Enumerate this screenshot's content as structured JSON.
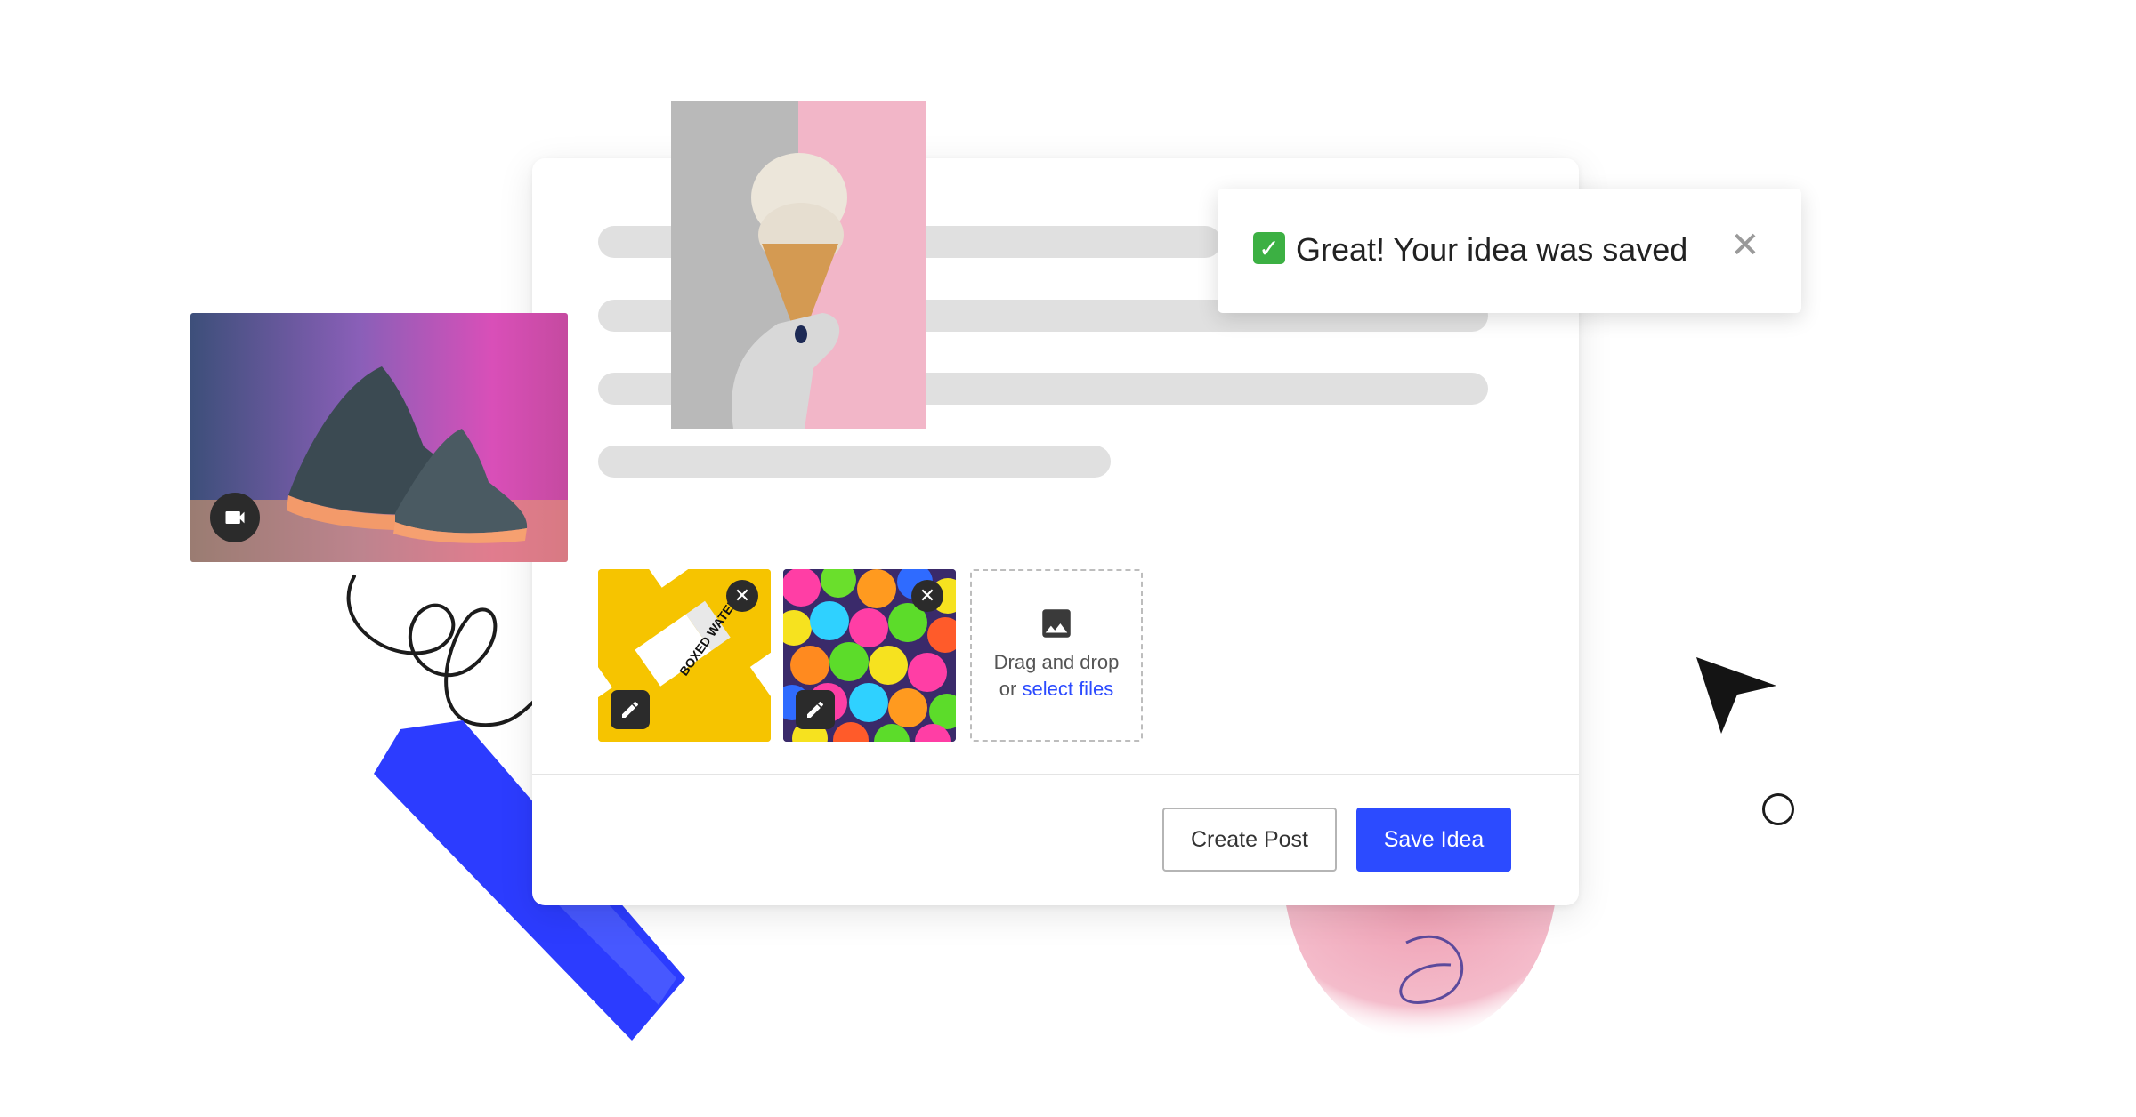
{
  "toast": {
    "message": "Great! Your idea was saved",
    "check_icon": "check-mark-button-icon",
    "close_icon": "close-icon"
  },
  "media": {
    "attachments": [
      {
        "name": "boxed-water-photo",
        "remove_icon": "close-icon",
        "edit_icon": "pencil-icon"
      },
      {
        "name": "colorful-gumballs-photo",
        "remove_icon": "close-icon",
        "edit_icon": "pencil-icon"
      }
    ],
    "dropzone": {
      "icon": "image-icon",
      "line1": "Drag and drop",
      "line2_prefix": "or",
      "line2_link": "select files"
    },
    "boxed_water_label": "BOXED WATER"
  },
  "actions": {
    "create_post_label": "Create Post",
    "save_idea_label": "Save Idea"
  },
  "decor": {
    "sneaker_badge_icon": "video-camera-icon",
    "cursor_icon": "mouse-pointer-icon"
  },
  "colors": {
    "primary": "#2c4bff",
    "success": "#3cb043",
    "skeleton": "#e0e0e0",
    "pink_blob": "#f0a6b8"
  }
}
